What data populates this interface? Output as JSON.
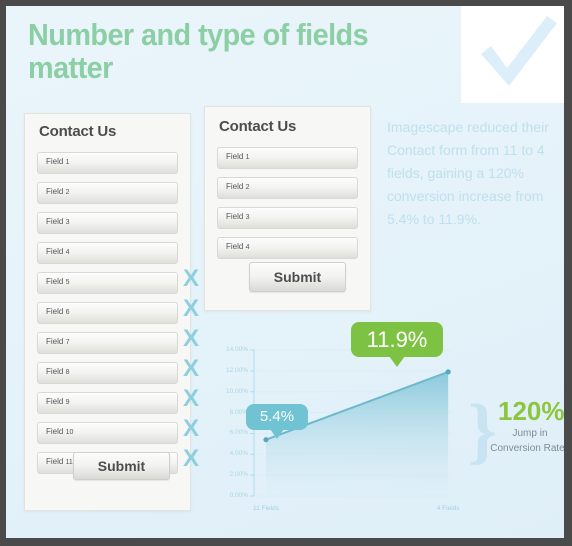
{
  "header": {
    "title": "Number and type of fields matter",
    "check_icon": "check-icon"
  },
  "panel_left": {
    "title": "Contact Us",
    "submit_label": "Submit",
    "fields": [
      {
        "name": "Field",
        "num": "1",
        "removed": false
      },
      {
        "name": "Field",
        "num": "2",
        "removed": false
      },
      {
        "name": "Field",
        "num": "3",
        "removed": false
      },
      {
        "name": "Field",
        "num": "4",
        "removed": false
      },
      {
        "name": "Field",
        "num": "5",
        "removed": true
      },
      {
        "name": "Field",
        "num": "6",
        "removed": true
      },
      {
        "name": "Field",
        "num": "7",
        "removed": true
      },
      {
        "name": "Field",
        "num": "8",
        "removed": true
      },
      {
        "name": "Field",
        "num": "9",
        "removed": true
      },
      {
        "name": "Field",
        "num": "10",
        "removed": true
      },
      {
        "name": "Field",
        "num": "11",
        "removed": true
      }
    ],
    "remove_mark": "X"
  },
  "panel_right": {
    "title": "Contact Us",
    "submit_label": "Submit",
    "fields": [
      {
        "name": "Field",
        "num": "1"
      },
      {
        "name": "Field",
        "num": "2"
      },
      {
        "name": "Field",
        "num": "3"
      },
      {
        "name": "Field",
        "num": "4"
      }
    ]
  },
  "description": "Imagescape reduced their Contact form from 11 to 4 fields, gaining a 120% conversion increase from 5.4% to 11.9%.",
  "callout": {
    "percent": "120%",
    "subtitle": "Jump in Conversion Rates",
    "brace_icon": "curly-brace-icon"
  },
  "colors": {
    "brand_green": "#8ccfa5",
    "accent_green": "#7dc243",
    "accent_blue": "#6fc3d3",
    "page_bg": "#e6f3fa",
    "chart_line": "#6cb8cc"
  },
  "chart_data": {
    "type": "line",
    "title": "",
    "xlabel": "",
    "ylabel": "",
    "categories": [
      "11 Fields",
      "4 Fields"
    ],
    "values": [
      5.4,
      11.9
    ],
    "value_labels": [
      "5.4%",
      "11.9%"
    ],
    "yticks": [
      "0.00%",
      "2.00%",
      "4.00%",
      "6.00%",
      "8.00%",
      "10.00%",
      "12.00%",
      "14.00%"
    ],
    "ytick_values": [
      0,
      2,
      4,
      6,
      8,
      10,
      12,
      14
    ],
    "ylim": [
      0,
      14
    ],
    "grid": true,
    "legend": "none",
    "area_fill": true
  }
}
